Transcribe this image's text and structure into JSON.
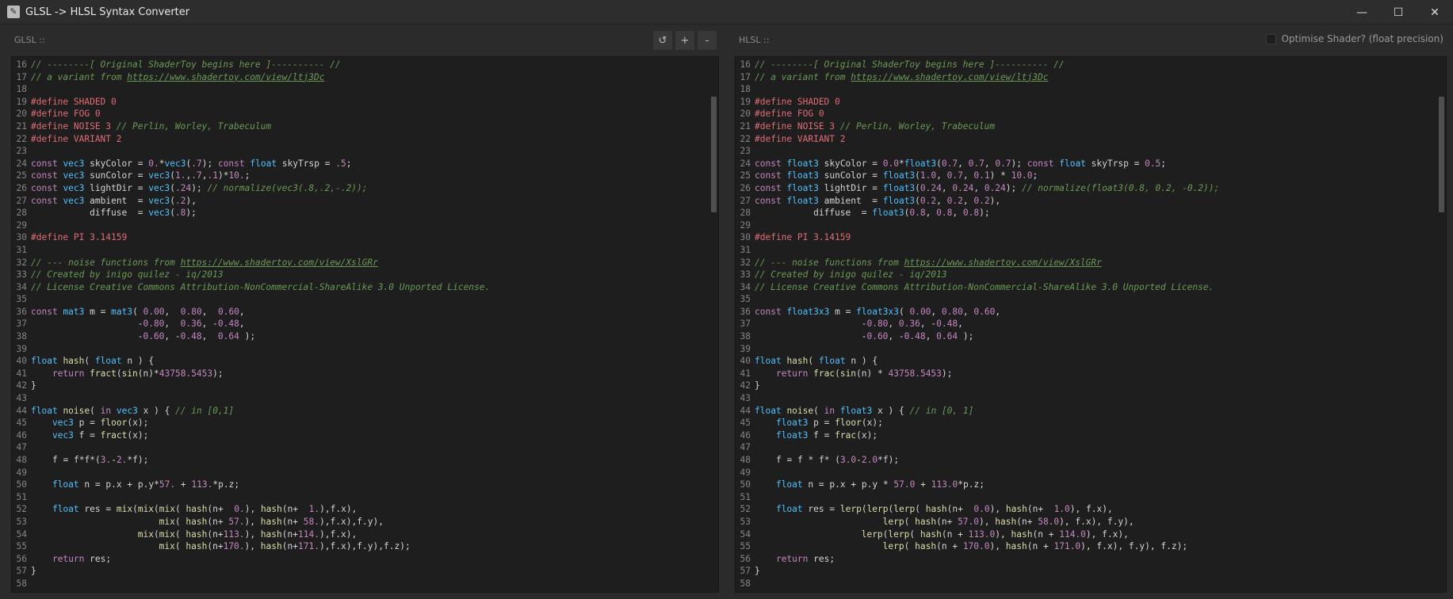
{
  "window": {
    "title": "GLSL -> HLSL Syntax Converter",
    "icon": "wrench-icon"
  },
  "glsl": {
    "label": "GLSL ::",
    "tools": [
      "↺",
      "+",
      "-"
    ],
    "lines": [
      {
        "n": "16",
        "code": "// --------[ Original ShaderToy begins here ]---------- //"
      },
      {
        "n": "17",
        "code": "// a variant from https://www.shadertoy.com/view/ltj3Dc"
      },
      {
        "n": "18",
        "code": ""
      },
      {
        "n": "19",
        "code": "#define SHADED 0"
      },
      {
        "n": "20",
        "code": "#define FOG 0"
      },
      {
        "n": "21",
        "code": "#define NOISE 3 // Perlin, Worley, Trabeculum"
      },
      {
        "n": "22",
        "code": "#define VARIANT 2"
      },
      {
        "n": "23",
        "code": ""
      },
      {
        "n": "24",
        "code": "const vec3 skyColor = 0.*vec3(.7); const float skyTrsp = .5;"
      },
      {
        "n": "25",
        "code": "const vec3 sunColor = vec3(1.,.7,.1)*10.;"
      },
      {
        "n": "26",
        "code": "const vec3 lightDir = vec3(.24); // normalize(vec3(.8,.2,-.2));"
      },
      {
        "n": "27",
        "code": "const vec3 ambient  = vec3(.2),"
      },
      {
        "n": "28",
        "code": "           diffuse  = vec3(.8);"
      },
      {
        "n": "29",
        "code": ""
      },
      {
        "n": "30",
        "code": "#define PI 3.14159"
      },
      {
        "n": "31",
        "code": ""
      },
      {
        "n": "32",
        "code": "// --- noise functions from https://www.shadertoy.com/view/XslGRr"
      },
      {
        "n": "33",
        "code": "// Created by inigo quilez - iq/2013"
      },
      {
        "n": "34",
        "code": "// License Creative Commons Attribution-NonCommercial-ShareAlike 3.0 Unported License."
      },
      {
        "n": "35",
        "code": ""
      },
      {
        "n": "36",
        "code": "const mat3 m = mat3( 0.00,  0.80,  0.60,"
      },
      {
        "n": "37",
        "code": "                    -0.80,  0.36, -0.48,"
      },
      {
        "n": "38",
        "code": "                    -0.60, -0.48,  0.64 );"
      },
      {
        "n": "39",
        "code": ""
      },
      {
        "n": "40",
        "code": "float hash( float n ) {"
      },
      {
        "n": "41",
        "code": "    return fract(sin(n)*43758.5453);"
      },
      {
        "n": "42",
        "code": "}"
      },
      {
        "n": "43",
        "code": ""
      },
      {
        "n": "44",
        "code": "float noise( in vec3 x ) { // in [0,1]"
      },
      {
        "n": "45",
        "code": "    vec3 p = floor(x);"
      },
      {
        "n": "46",
        "code": "    vec3 f = fract(x);"
      },
      {
        "n": "47",
        "code": ""
      },
      {
        "n": "48",
        "code": "    f = f*f*(3.-2.*f);"
      },
      {
        "n": "49",
        "code": ""
      },
      {
        "n": "50",
        "code": "    float n = p.x + p.y*57. + 113.*p.z;"
      },
      {
        "n": "51",
        "code": ""
      },
      {
        "n": "52",
        "code": "    float res = mix(mix(mix( hash(n+  0.), hash(n+  1.),f.x),"
      },
      {
        "n": "53",
        "code": "                        mix( hash(n+ 57.), hash(n+ 58.),f.x),f.y),"
      },
      {
        "n": "54",
        "code": "                    mix(mix( hash(n+113.), hash(n+114.),f.x),"
      },
      {
        "n": "55",
        "code": "                        mix( hash(n+170.), hash(n+171.),f.x),f.y),f.z);"
      },
      {
        "n": "56",
        "code": "    return res;"
      },
      {
        "n": "57",
        "code": "}"
      },
      {
        "n": "58",
        "code": ""
      }
    ]
  },
  "hlsl": {
    "label": "HLSL ::",
    "option_label": "Optimise Shader? (float precision)",
    "lines": [
      {
        "n": "16",
        "code": "// --------[ Original ShaderToy begins here ]---------- //"
      },
      {
        "n": "17",
        "code": "// a variant from https://www.shadertoy.com/view/ltj3Dc"
      },
      {
        "n": "18",
        "code": ""
      },
      {
        "n": "19",
        "code": "#define SHADED 0"
      },
      {
        "n": "20",
        "code": "#define FOG 0"
      },
      {
        "n": "21",
        "code": "#define NOISE 3 // Perlin, Worley, Trabeculum"
      },
      {
        "n": "22",
        "code": "#define VARIANT 2"
      },
      {
        "n": "23",
        "code": ""
      },
      {
        "n": "24",
        "code": "const float3 skyColor = 0.0*float3(0.7, 0.7, 0.7); const float skyTrsp = 0.5;"
      },
      {
        "n": "25",
        "code": "const float3 sunColor = float3(1.0, 0.7, 0.1) * 10.0;"
      },
      {
        "n": "26",
        "code": "const float3 lightDir = float3(0.24, 0.24, 0.24); // normalize(float3(0.8, 0.2, -0.2));"
      },
      {
        "n": "27",
        "code": "const float3 ambient  = float3(0.2, 0.2, 0.2),"
      },
      {
        "n": "28",
        "code": "           diffuse  = float3(0.8, 0.8, 0.8);"
      },
      {
        "n": "29",
        "code": ""
      },
      {
        "n": "30",
        "code": "#define PI 3.14159"
      },
      {
        "n": "31",
        "code": ""
      },
      {
        "n": "32",
        "code": "// --- noise functions from https://www.shadertoy.com/view/XslGRr"
      },
      {
        "n": "33",
        "code": "// Created by inigo quilez - iq/2013"
      },
      {
        "n": "34",
        "code": "// License Creative Commons Attribution-NonCommercial-ShareAlike 3.0 Unported License."
      },
      {
        "n": "35",
        "code": ""
      },
      {
        "n": "36",
        "code": "const float3x3 m = float3x3( 0.00, 0.80, 0.60,"
      },
      {
        "n": "37",
        "code": "                    -0.80, 0.36, -0.48,"
      },
      {
        "n": "38",
        "code": "                    -0.60, -0.48, 0.64 );"
      },
      {
        "n": "39",
        "code": ""
      },
      {
        "n": "40",
        "code": "float hash( float n ) {"
      },
      {
        "n": "41",
        "code": "    return frac(sin(n) * 43758.5453);"
      },
      {
        "n": "42",
        "code": "}"
      },
      {
        "n": "43",
        "code": ""
      },
      {
        "n": "44",
        "code": "float noise( in float3 x ) { // in [0, 1]"
      },
      {
        "n": "45",
        "code": "    float3 p = floor(x);"
      },
      {
        "n": "46",
        "code": "    float3 f = frac(x);"
      },
      {
        "n": "47",
        "code": ""
      },
      {
        "n": "48",
        "code": "    f = f * f* (3.0-2.0*f);"
      },
      {
        "n": "49",
        "code": ""
      },
      {
        "n": "50",
        "code": "    float n = p.x + p.y * 57.0 + 113.0*p.z;"
      },
      {
        "n": "51",
        "code": ""
      },
      {
        "n": "52",
        "code": "    float res = lerp(lerp(lerp( hash(n+  0.0), hash(n+  1.0), f.x),"
      },
      {
        "n": "53",
        "code": "                        lerp( hash(n+ 57.0), hash(n+ 58.0), f.x), f.y),"
      },
      {
        "n": "54",
        "code": "                    lerp(lerp( hash(n + 113.0), hash(n + 114.0), f.x),"
      },
      {
        "n": "55",
        "code": "                        lerp( hash(n + 170.0), hash(n + 171.0), f.x), f.y), f.z);"
      },
      {
        "n": "56",
        "code": "    return res;"
      },
      {
        "n": "57",
        "code": "}"
      },
      {
        "n": "58",
        "code": ""
      }
    ]
  },
  "colors": {
    "background": "#2b2b2b",
    "editor_bg": "#1e1e1e",
    "comment": "#6a9955",
    "define": "#e06c75",
    "type": "#4ec9b0",
    "number": "#c586c0",
    "function": "#dcdcaa"
  }
}
